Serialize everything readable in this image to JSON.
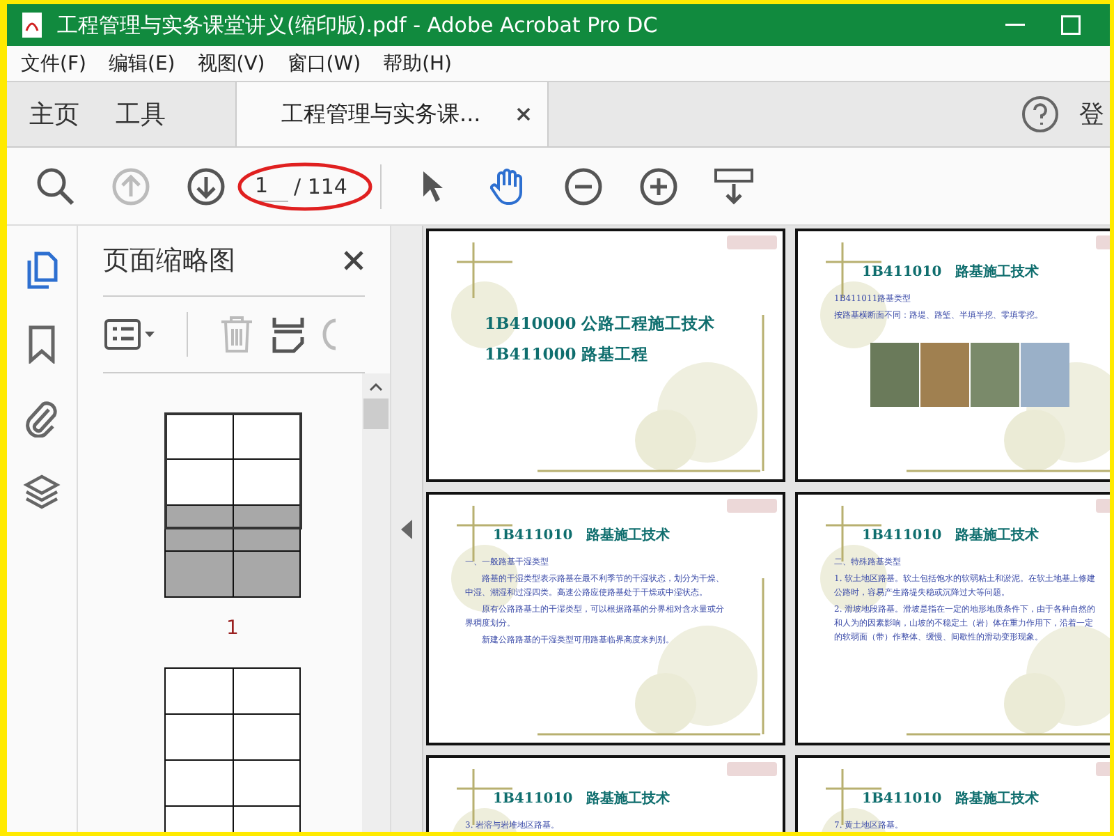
{
  "window": {
    "title": "工程管理与实务课堂讲义(缩印版).pdf - Adobe Acrobat Pro DC"
  },
  "menu": [
    "文件(F)",
    "编辑(E)",
    "视图(V)",
    "窗口(W)",
    "帮助(H)"
  ],
  "tabs": [
    {
      "label": "主页",
      "kind": "nav",
      "selected": false
    },
    {
      "label": "工具",
      "kind": "nav",
      "selected": false
    },
    {
      "label": "工程管理与实务课...",
      "kind": "document",
      "selected": true
    }
  ],
  "account_label": "登",
  "toolbar": {
    "page_input": "1",
    "page_total": "/ 114",
    "tools": [
      {
        "kind": "select",
        "selected": false
      },
      {
        "kind": "hand",
        "selected": true
      }
    ]
  },
  "rail": [
    {
      "kind": "pages",
      "selected": true
    },
    {
      "kind": "bookmark",
      "selected": false
    },
    {
      "kind": "attachment",
      "selected": false
    },
    {
      "kind": "layers",
      "selected": false
    }
  ],
  "side_panel": {
    "title": "页面缩略图",
    "thumbnails": [
      {
        "label": "1",
        "selected": true
      },
      {
        "selected": false
      }
    ]
  },
  "pages": [
    {
      "kind": "title",
      "lines": [
        "1B410000  公路工程施工技术",
        "1B411000  路基工程"
      ]
    },
    {
      "kind": "photo",
      "heading": "1B411010　路基施工技术",
      "paragraphs": [
        "1B411011路基类型",
        "按路基横断面不同：路堤、路堑、半填半挖、零填零挖。"
      ]
    },
    {
      "kind": "text",
      "heading": "1B411010　路基施工技术",
      "paragraphs": [
        "一、一般路基干湿类型",
        "　　路基的干湿类型表示路基在最不利季节的干湿状态，划分为干燥、中湿、潮湿和过湿四类。高速公路应使路基处于干燥或中湿状态。",
        "　　原有公路路基土的干湿类型，可以根据路基的分界相对含水量或分界稠度划分。",
        "　　新建公路路基的干湿类型可用路基临界高度来判别。"
      ]
    },
    {
      "kind": "text",
      "heading": "1B411010　路基施工技术",
      "paragraphs": [
        "二、特殊路基类型",
        "1. 软土地区路基。软土包括饱水的软弱粘土和淤泥。在软土地基上修建公路时，容易产生路堤失稳或沉降过大等问题。",
        "2. 滑坡地段路基。滑坡是指在一定的地形地质条件下，由于各种自然的和人为的因素影响，山坡的不稳定土（岩）体在重力作用下，沿着一定的软弱面（带）作整体、缓慢、间歇性的滑动变形现象。"
      ]
    },
    {
      "kind": "text",
      "heading": "1B411010　路基施工技术",
      "paragraphs": [
        "3. 岩溶与岩堆地区路基。"
      ]
    },
    {
      "kind": "text",
      "heading": "1B411010　路基施工技术",
      "paragraphs": [
        "7. 黄土地区路基。"
      ]
    }
  ]
}
